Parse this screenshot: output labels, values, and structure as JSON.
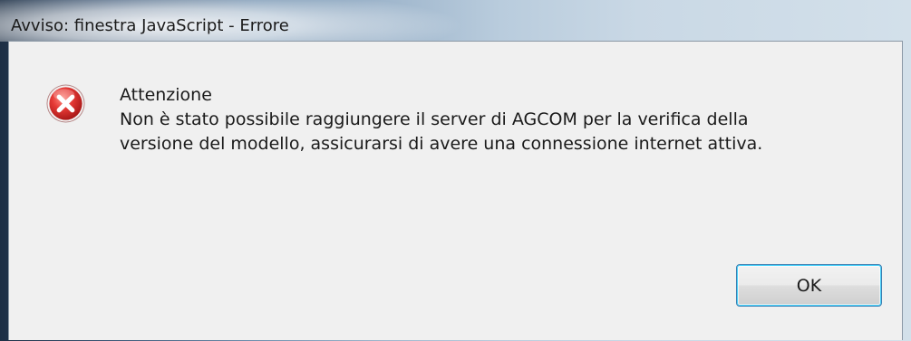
{
  "window": {
    "title": "Avviso: finestra JavaScript - Errore"
  },
  "dialog": {
    "icon": "error-icon",
    "heading": "Attenzione",
    "message_line1": "Non è stato possibile raggiungere il server di AGCOM per la verifica della",
    "message_line2": "versione del modello, assicurarsi di avere una connessione internet attiva.",
    "ok_label": "OK"
  },
  "colors": {
    "icon_red": "#c62828",
    "button_focus_border": "#3c7fb1",
    "dialog_background": "#f0f0f0"
  }
}
